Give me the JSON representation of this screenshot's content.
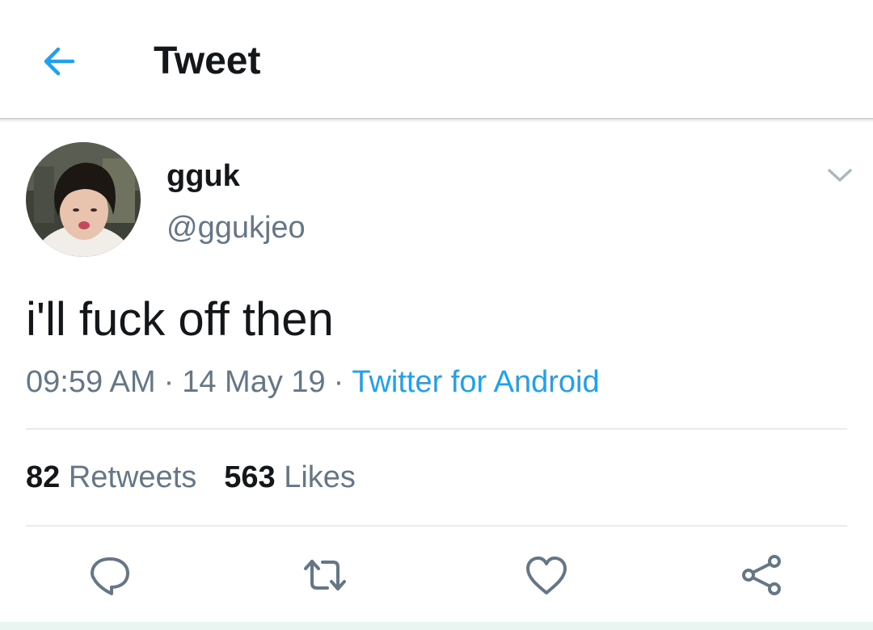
{
  "header": {
    "title": "Tweet",
    "back_icon": "arrow-left-icon",
    "accent": "#1da1f2"
  },
  "tweet": {
    "author": {
      "name": "gguk",
      "handle": "@ggukjeo",
      "avatar_icon": "user-avatar-photo"
    },
    "more_icon": "chevron-down-icon",
    "text": "i'll fuck off then",
    "time": "09:59 AM",
    "date": "14 May 19",
    "separator": "·",
    "source": "Twitter for Android"
  },
  "stats": {
    "retweets_count": "82",
    "retweets_label": "Retweets",
    "likes_count": "563",
    "likes_label": "Likes"
  },
  "actions": [
    {
      "icon": "reply-icon"
    },
    {
      "icon": "retweet-icon"
    },
    {
      "icon": "like-heart-icon"
    },
    {
      "icon": "share-icon"
    }
  ],
  "colors": {
    "text": "#14171a",
    "secondary": "#657786",
    "link": "#1da1f2",
    "divider": "#e6ecf0"
  }
}
